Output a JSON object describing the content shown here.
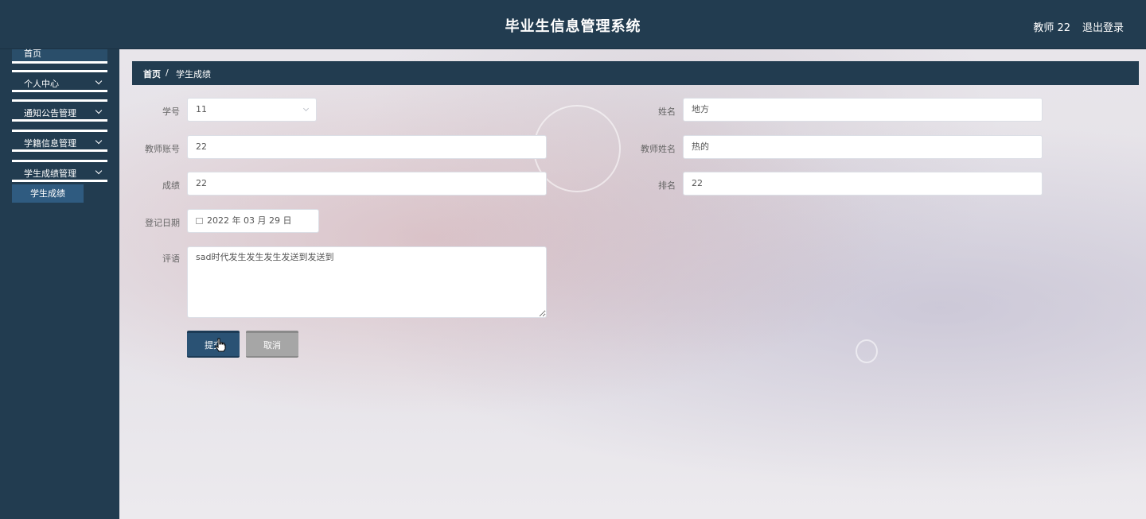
{
  "header": {
    "title": "毕业生信息管理系统",
    "user": "教师 22",
    "logout": "退出登录"
  },
  "sidebar": {
    "home": "首页",
    "items": [
      {
        "label": "个人中心"
      },
      {
        "label": "通知公告管理"
      },
      {
        "label": "学籍信息管理"
      },
      {
        "label": "学生成绩管理"
      }
    ],
    "active_sub": "学生成绩"
  },
  "breadcrumb": {
    "home": "首页",
    "separator": "/",
    "current": "学生成绩"
  },
  "form": {
    "student_id": {
      "label": "学号",
      "value": "11"
    },
    "name": {
      "label": "姓名",
      "value": "地方"
    },
    "teacher_account": {
      "label": "教师账号",
      "value": "22"
    },
    "teacher_name": {
      "label": "教师姓名",
      "value": "热的"
    },
    "score": {
      "label": "成绩",
      "value": "22"
    },
    "rank": {
      "label": "排名",
      "value": "22"
    },
    "record_date": {
      "label": "登记日期",
      "value": "2022 年 03 月 29 日"
    },
    "comment": {
      "label": "评语",
      "value": "sad时代发生发生发生发送到发送到"
    },
    "submit": "提交",
    "cancel": "取消"
  },
  "colors": {
    "primary": "#223c50",
    "submit": "#2a5274",
    "cancel": "#a6a6a6"
  }
}
